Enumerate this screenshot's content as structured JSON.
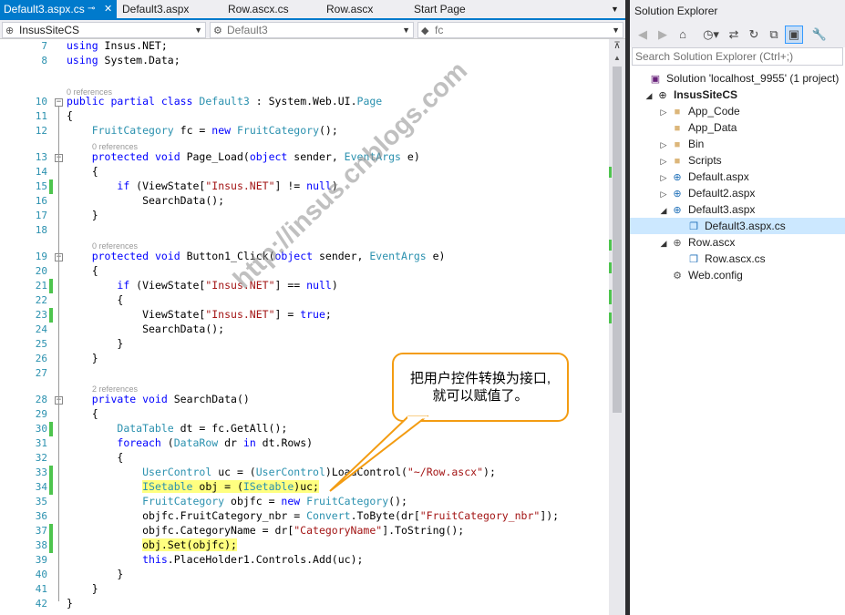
{
  "tabs": [
    {
      "label": "Default3.aspx.cs",
      "active": true
    },
    {
      "label": "Default3.aspx",
      "active": false
    },
    {
      "label": "Row.ascx.cs",
      "active": false
    },
    {
      "label": "Row.ascx",
      "active": false
    },
    {
      "label": "Start Page",
      "active": false
    }
  ],
  "navbar": {
    "project": "InsusSiteCS",
    "class": "Default3",
    "member": "fc"
  },
  "code_lines": [
    {
      "n": "7",
      "parts": [
        [
          "k",
          "using"
        ],
        [
          "p",
          " Insus.NET;"
        ]
      ]
    },
    {
      "n": "8",
      "parts": [
        [
          "k",
          "using"
        ],
        [
          "p",
          " System.Data;"
        ]
      ]
    },
    {
      "n": "10",
      "parts": [
        [
          "k",
          "public partial class"
        ],
        [
          "p",
          " "
        ],
        [
          "t",
          "Default3"
        ],
        [
          "p",
          " : System.Web.UI."
        ],
        [
          "t",
          "Page"
        ]
      ]
    },
    {
      "n": "11",
      "parts": [
        [
          "p",
          "{"
        ]
      ]
    },
    {
      "n": "12",
      "parts": [
        [
          "p",
          "    "
        ],
        [
          "t",
          "FruitCategory"
        ],
        [
          "p",
          " fc = "
        ],
        [
          "k",
          "new"
        ],
        [
          "p",
          " "
        ],
        [
          "t",
          "FruitCategory"
        ],
        [
          "p",
          "();"
        ]
      ]
    },
    {
      "n": "13",
      "parts": [
        [
          "p",
          "    "
        ],
        [
          "k",
          "protected void"
        ],
        [
          "p",
          " Page_Load("
        ],
        [
          "k",
          "object"
        ],
        [
          "p",
          " sender, "
        ],
        [
          "t",
          "EventArgs"
        ],
        [
          "p",
          " e)"
        ]
      ]
    },
    {
      "n": "14",
      "parts": [
        [
          "p",
          "    {"
        ]
      ]
    },
    {
      "n": "15",
      "parts": [
        [
          "p",
          "        "
        ],
        [
          "k",
          "if"
        ],
        [
          "p",
          " (ViewState["
        ],
        [
          "s",
          "\"Insus.NET\""
        ],
        [
          "p",
          "] != "
        ],
        [
          "k",
          "null"
        ],
        [
          "p",
          ")"
        ]
      ]
    },
    {
      "n": "16",
      "parts": [
        [
          "p",
          "            SearchData();"
        ]
      ]
    },
    {
      "n": "17",
      "parts": [
        [
          "p",
          "    }"
        ]
      ]
    },
    {
      "n": "18",
      "parts": [
        [
          "p",
          ""
        ]
      ]
    },
    {
      "n": "19",
      "parts": [
        [
          "p",
          "    "
        ],
        [
          "k",
          "protected void"
        ],
        [
          "p",
          " Button1_Click("
        ],
        [
          "k",
          "object"
        ],
        [
          "p",
          " sender, "
        ],
        [
          "t",
          "EventArgs"
        ],
        [
          "p",
          " e)"
        ]
      ]
    },
    {
      "n": "20",
      "parts": [
        [
          "p",
          "    {"
        ]
      ]
    },
    {
      "n": "21",
      "parts": [
        [
          "p",
          "        "
        ],
        [
          "k",
          "if"
        ],
        [
          "p",
          " (ViewState["
        ],
        [
          "s",
          "\"Insus.NET\""
        ],
        [
          "p",
          "] == "
        ],
        [
          "k",
          "null"
        ],
        [
          "p",
          ")"
        ]
      ]
    },
    {
      "n": "22",
      "parts": [
        [
          "p",
          "        {"
        ]
      ]
    },
    {
      "n": "23",
      "parts": [
        [
          "p",
          "            ViewState["
        ],
        [
          "s",
          "\"Insus.NET\""
        ],
        [
          "p",
          "] = "
        ],
        [
          "k",
          "true"
        ],
        [
          "p",
          ";"
        ]
      ]
    },
    {
      "n": "24",
      "parts": [
        [
          "p",
          "            SearchData();"
        ]
      ]
    },
    {
      "n": "25",
      "parts": [
        [
          "p",
          "        }"
        ]
      ]
    },
    {
      "n": "26",
      "parts": [
        [
          "p",
          "    }"
        ]
      ]
    },
    {
      "n": "27",
      "parts": [
        [
          "p",
          ""
        ]
      ]
    },
    {
      "n": "28",
      "parts": [
        [
          "p",
          "    "
        ],
        [
          "k",
          "private void"
        ],
        [
          "p",
          " SearchData()"
        ]
      ]
    },
    {
      "n": "29",
      "parts": [
        [
          "p",
          "    {"
        ]
      ]
    },
    {
      "n": "30",
      "parts": [
        [
          "p",
          "        "
        ],
        [
          "t",
          "DataTable"
        ],
        [
          "p",
          " dt = fc.GetAll();"
        ]
      ]
    },
    {
      "n": "31",
      "parts": [
        [
          "p",
          "        "
        ],
        [
          "k",
          "foreach"
        ],
        [
          "p",
          " ("
        ],
        [
          "t",
          "DataRow"
        ],
        [
          "p",
          " dr "
        ],
        [
          "k",
          "in"
        ],
        [
          "p",
          " dt.Rows)"
        ]
      ]
    },
    {
      "n": "32",
      "parts": [
        [
          "p",
          "        {"
        ]
      ]
    },
    {
      "n": "33",
      "parts": [
        [
          "p",
          "            "
        ],
        [
          "t",
          "UserControl"
        ],
        [
          "p",
          " uc = ("
        ],
        [
          "t",
          "UserControl"
        ],
        [
          "p",
          ")LoadControl("
        ],
        [
          "s",
          "\"~/Row.ascx\""
        ],
        [
          "p",
          ");"
        ]
      ]
    },
    {
      "n": "34",
      "parts": [
        [
          "p",
          "            "
        ],
        [
          "h1",
          ""
        ]
      ]
    },
    {
      "n": "35",
      "parts": [
        [
          "p",
          "            "
        ],
        [
          "t",
          "FruitCategory"
        ],
        [
          "p",
          " objfc = "
        ],
        [
          "k",
          "new"
        ],
        [
          "p",
          " "
        ],
        [
          "t",
          "FruitCategory"
        ],
        [
          "p",
          "();"
        ]
      ]
    },
    {
      "n": "36",
      "parts": [
        [
          "p",
          "            objfc.FruitCategory_nbr = "
        ],
        [
          "t",
          "Convert"
        ],
        [
          "p",
          ".ToByte(dr["
        ],
        [
          "s",
          "\"FruitCategory_nbr\""
        ],
        [
          "p",
          "]);"
        ]
      ]
    },
    {
      "n": "37",
      "parts": [
        [
          "p",
          "            objfc.CategoryName = dr["
        ],
        [
          "s",
          "\"CategoryName\""
        ],
        [
          "p",
          "].ToString();"
        ]
      ]
    },
    {
      "n": "38",
      "parts": [
        [
          "p",
          "            "
        ],
        [
          "h2",
          ""
        ]
      ]
    },
    {
      "n": "39",
      "parts": [
        [
          "p",
          "            "
        ],
        [
          "k",
          "this"
        ],
        [
          "p",
          ".PlaceHolder1.Controls.Add(uc);"
        ]
      ]
    },
    {
      "n": "40",
      "parts": [
        [
          "p",
          "        }"
        ]
      ]
    },
    {
      "n": "41",
      "parts": [
        [
          "p",
          "    }"
        ]
      ]
    },
    {
      "n": "42",
      "parts": [
        [
          "p",
          "}"
        ]
      ]
    }
  ],
  "highlight_34": {
    "a": "ISetable",
    "b": " obj = (",
    "c": "ISetable",
    "d": ")uc;"
  },
  "highlight_38": "obj.Set(objfc);",
  "references": {
    "r10": "0 references",
    "r13": "0 references",
    "r19": "0 references",
    "r28": "2 references"
  },
  "callout": {
    "line1": "把用户控件转换为接口,",
    "line2": "就可以赋值了。"
  },
  "watermark": "http://insus.cnblogs.com",
  "solution_explorer": {
    "title": "Solution Explorer",
    "search_placeholder": "Search Solution Explorer (Ctrl+;)",
    "items": [
      {
        "label": "Solution 'localhost_9955' (1 project)",
        "icon": "solution-icon"
      },
      {
        "label": "InsusSiteCS",
        "icon": "website-icon"
      },
      {
        "label": "App_Code",
        "icon": "folder-icon"
      },
      {
        "label": "App_Data",
        "icon": "folder-icon"
      },
      {
        "label": "Bin",
        "icon": "folder-icon"
      },
      {
        "label": "Scripts",
        "icon": "folder-icon"
      },
      {
        "label": "Default.aspx",
        "icon": "web-page-icon"
      },
      {
        "label": "Default2.aspx",
        "icon": "web-page-icon"
      },
      {
        "label": "Default3.aspx",
        "icon": "web-page-icon"
      },
      {
        "label": "Default3.aspx.cs",
        "icon": "cs-file-icon"
      },
      {
        "label": "Row.ascx",
        "icon": "user-control-icon"
      },
      {
        "label": "Row.ascx.cs",
        "icon": "cs-file-icon"
      },
      {
        "label": "Web.config",
        "icon": "config-file-icon"
      }
    ]
  },
  "colors": {
    "accent": "#007acc",
    "keyword": "#0000ff",
    "type": "#2b91af",
    "string": "#a31515",
    "change_bar": "#4ec44e",
    "highlight": "#ffff80",
    "callout_border": "#f39c12"
  }
}
